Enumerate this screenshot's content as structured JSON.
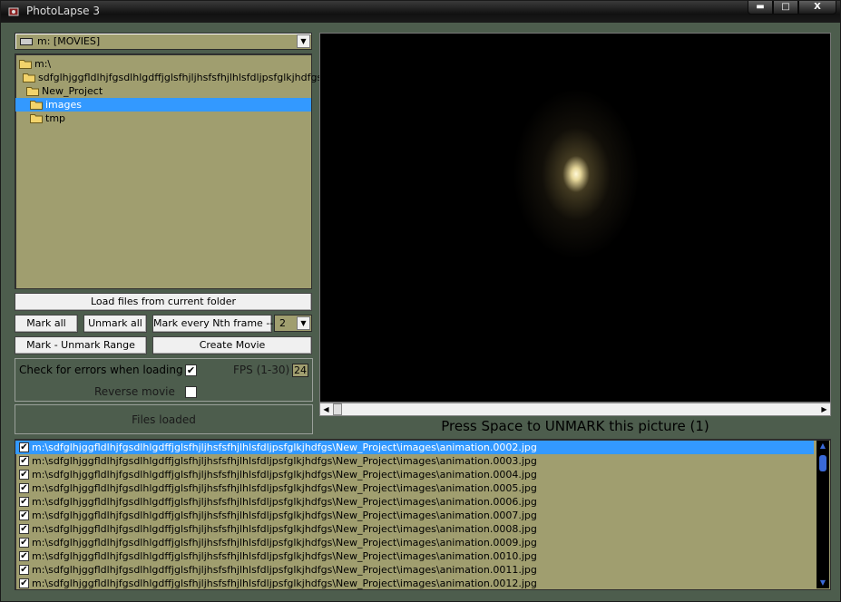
{
  "window": {
    "title": "PhotoLapse 3",
    "minimize": "▬",
    "maximize": "□",
    "close": "X"
  },
  "drive": {
    "selected": "m: [MOVIES]",
    "arrow": "▼"
  },
  "folder_tree": [
    {
      "label": "m:\\",
      "indent": 0,
      "selected": false
    },
    {
      "label": "sdfglhjggfldlhjfgsdlhlgdffjglsfhjljhsfsfhjlhlsfdljpsfglkjhdfgs",
      "indent": 1,
      "selected": false
    },
    {
      "label": "New_Project",
      "indent": 2,
      "selected": false
    },
    {
      "label": "images",
      "indent": 3,
      "selected": true
    },
    {
      "label": "tmp",
      "indent": 3,
      "selected": false
    }
  ],
  "buttons": {
    "load_files": "Load files from current folder",
    "mark_all": "Mark all",
    "unmark_all": "Unmark all",
    "mark_nth": "Mark every Nth frame -->",
    "mark_range": "Mark - Unmark Range",
    "create_movie": "Create Movie"
  },
  "nth_value": "2",
  "options": {
    "check_errors_label": "Check for errors when loading",
    "check_errors_checked": "✔",
    "fps_label": "FPS (1-30)",
    "fps_value": "24",
    "reverse_label": "Reverse movie",
    "reverse_checked": ""
  },
  "status": "Files loaded",
  "preview_caption": "Press Space to UNMARK this picture (1)",
  "hscroll": {
    "left": "◀",
    "right": "▶"
  },
  "vscroll": {
    "up": "▲",
    "down": "▼"
  },
  "file_list": [
    {
      "path": "m:\\sdfglhjggfldlhjfgsdlhlgdffjglsfhjljhsfsfhjlhlsfdljpsfglkjhdfgs\\New_Project\\images\\animation.0002.jpg",
      "checked": "✔",
      "selected": true
    },
    {
      "path": "m:\\sdfglhjggfldlhjfgsdlhlgdffjglsfhjljhsfsfhjlhlsfdljpsfglkjhdfgs\\New_Project\\images\\animation.0003.jpg",
      "checked": "✔",
      "selected": false
    },
    {
      "path": "m:\\sdfglhjggfldlhjfgsdlhlgdffjglsfhjljhsfsfhjlhlsfdljpsfglkjhdfgs\\New_Project\\images\\animation.0004.jpg",
      "checked": "✔",
      "selected": false
    },
    {
      "path": "m:\\sdfglhjggfldlhjfgsdlhlgdffjglsfhjljhsfsfhjlhlsfdljpsfglkjhdfgs\\New_Project\\images\\animation.0005.jpg",
      "checked": "✔",
      "selected": false
    },
    {
      "path": "m:\\sdfglhjggfldlhjfgsdlhlgdffjglsfhjljhsfsfhjlhlsfdljpsfglkjhdfgs\\New_Project\\images\\animation.0006.jpg",
      "checked": "✔",
      "selected": false
    },
    {
      "path": "m:\\sdfglhjggfldlhjfgsdlhlgdffjglsfhjljhsfsfhjlhlsfdljpsfglkjhdfgs\\New_Project\\images\\animation.0007.jpg",
      "checked": "✔",
      "selected": false
    },
    {
      "path": "m:\\sdfglhjggfldlhjfgsdlhlgdffjglsfhjljhsfsfhjlhlsfdljpsfglkjhdfgs\\New_Project\\images\\animation.0008.jpg",
      "checked": "✔",
      "selected": false
    },
    {
      "path": "m:\\sdfglhjggfldlhjfgsdlhlgdffjglsfhjljhsfsfhjlhlsfdljpsfglkjhdfgs\\New_Project\\images\\animation.0009.jpg",
      "checked": "✔",
      "selected": false
    },
    {
      "path": "m:\\sdfglhjggfldlhjfgsdlhlgdffjglsfhjljhsfsfhjlhlsfdljpsfglkjhdfgs\\New_Project\\images\\animation.0010.jpg",
      "checked": "✔",
      "selected": false
    },
    {
      "path": "m:\\sdfglhjggfldlhjfgsdlhlgdffjglsfhjljhsfsfhjlhlsfdljpsfglkjhdfgs\\New_Project\\images\\animation.0011.jpg",
      "checked": "✔",
      "selected": false
    },
    {
      "path": "m:\\sdfglhjggfldlhjfgsdlhlgdffjglsfhjljhsfsfhjlhlsfdljpsfglkjhdfgs\\New_Project\\images\\animation.0012.jpg",
      "checked": "✔",
      "selected": false
    }
  ],
  "colors": {
    "panel_bg": "#4d5d4d",
    "list_bg": "#a09e6f",
    "selection": "#3399ff"
  }
}
